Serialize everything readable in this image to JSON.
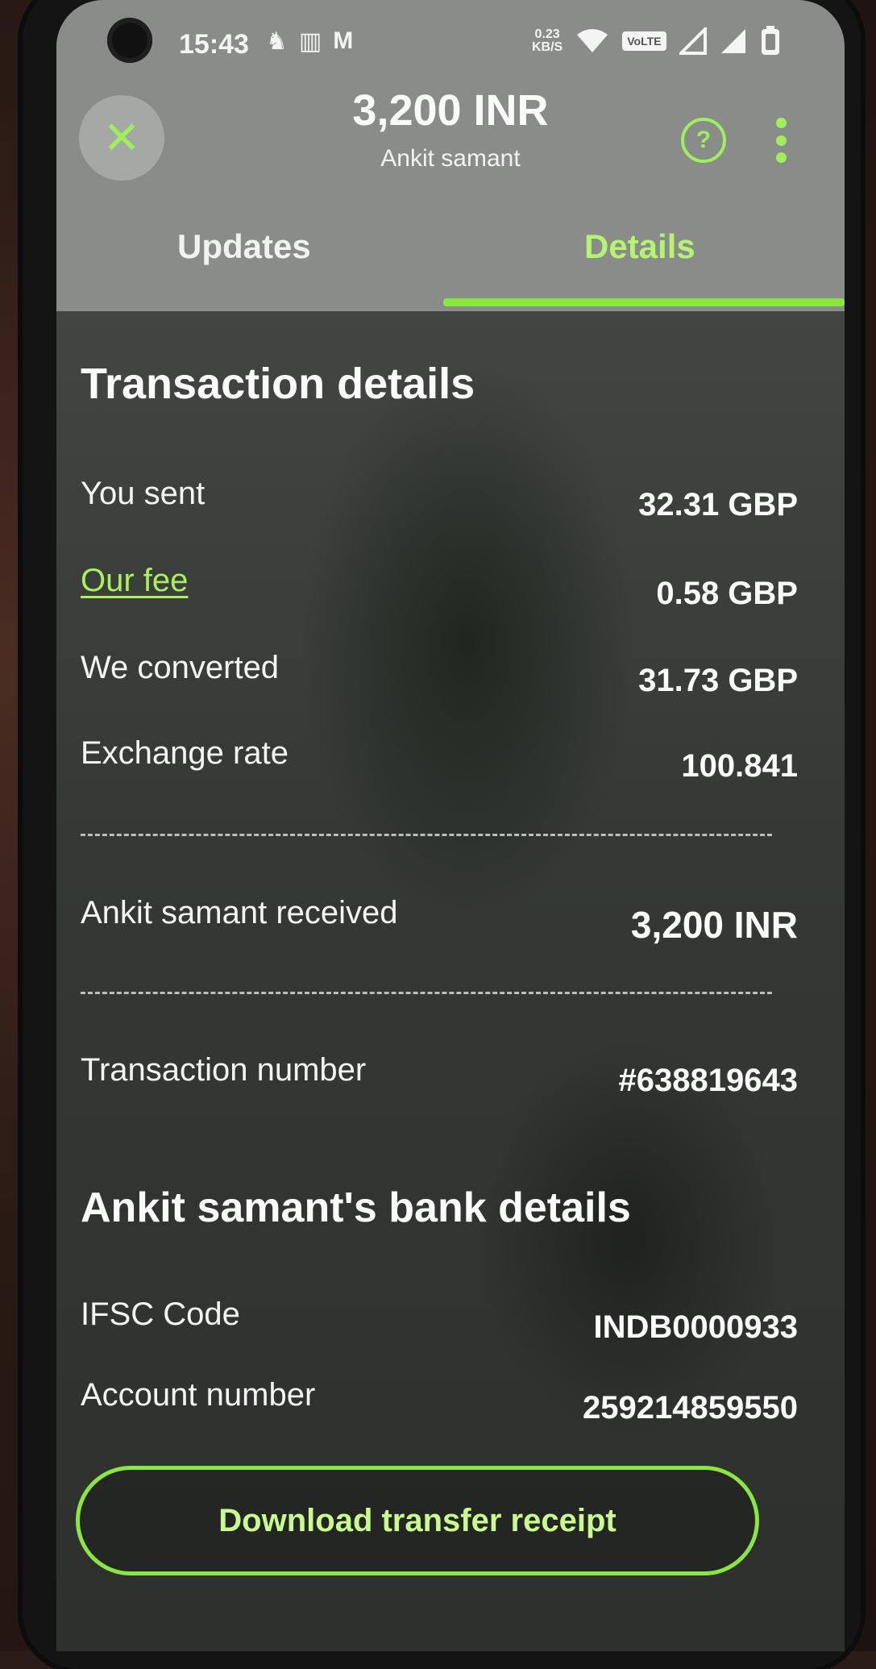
{
  "status_bar": {
    "time": "15:43",
    "net_speed_value": "0.23",
    "net_speed_unit": "KB/S",
    "volte": "VoLTE"
  },
  "header": {
    "amount": "3,200 INR",
    "recipient": "Ankit samant"
  },
  "tabs": [
    {
      "label": "Updates",
      "active": false
    },
    {
      "label": "Details",
      "active": true
    }
  ],
  "transaction": {
    "title": "Transaction details",
    "rows": [
      {
        "label": "You sent",
        "value": "32.31 GBP"
      },
      {
        "label": "Our fee",
        "value": "0.58 GBP"
      },
      {
        "label": "We converted",
        "value": "31.73 GBP"
      },
      {
        "label": "Exchange rate",
        "value": "100.841"
      }
    ],
    "received_label": "Ankit samant received",
    "received_value": "3,200 INR",
    "number_label": "Transaction number",
    "number_value": "#638819643"
  },
  "bank": {
    "title": "Ankit samant's bank details",
    "rows": [
      {
        "label": "IFSC Code",
        "value": "INDB0000933"
      },
      {
        "label": "Account number",
        "value": "259214859550"
      }
    ]
  },
  "actions": {
    "download_label": "Download transfer receipt"
  },
  "colors": {
    "accent": "#9ef05a",
    "header_bg": "#8a8c8a",
    "content_bg": "#353835"
  }
}
